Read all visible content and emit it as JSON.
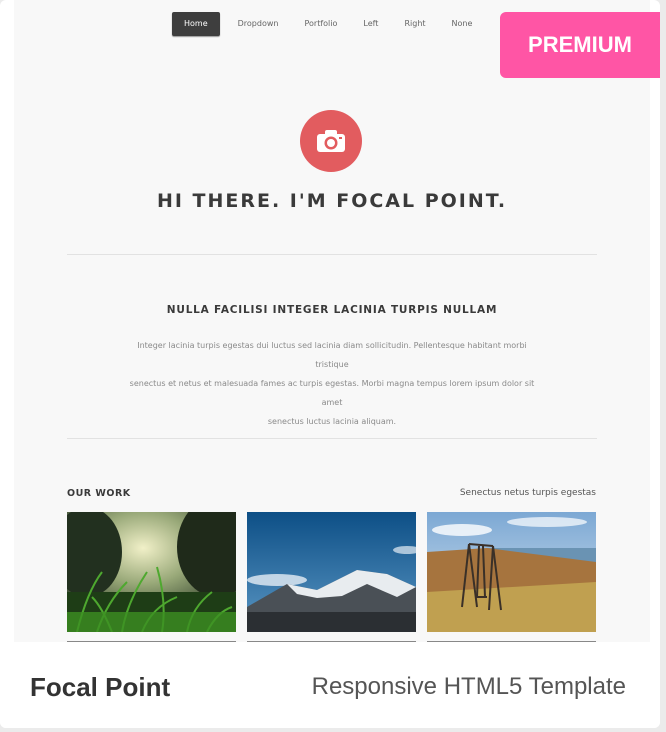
{
  "nav": {
    "items": [
      {
        "label": "Home",
        "active": true
      },
      {
        "label": "Dropdown"
      },
      {
        "label": "Portfolio"
      },
      {
        "label": "Left"
      },
      {
        "label": "Right"
      },
      {
        "label": "None"
      }
    ]
  },
  "badge": {
    "label": "PREMIUM",
    "color": "#ff55a5"
  },
  "hero": {
    "icon": "camera-icon",
    "title": "HI THERE. I'M FOCAL POINT.",
    "accent": "#e25c5f"
  },
  "intro": {
    "heading": "NULLA FACILISI INTEGER LACINIA TURPIS NULLAM",
    "lines": [
      "Integer lacinia turpis egestas dui luctus sed lacinia diam sollicitudin. Pellentesque habitant morbi tristique",
      "senectus et netus et malesuada fames ac turpis egestas. Morbi magna tempus lorem ipsum dolor sit amet",
      "senectus luctus lacinia aliquam."
    ]
  },
  "work": {
    "heading": "OUR WORK",
    "tagline": "Senectus netus turpis egestas",
    "thumbnails": [
      "grass-photo",
      "mountain-photo",
      "swing-photo"
    ]
  },
  "footer": {
    "title": "Focal Point",
    "subtitle": "Responsive HTML5 Template"
  }
}
